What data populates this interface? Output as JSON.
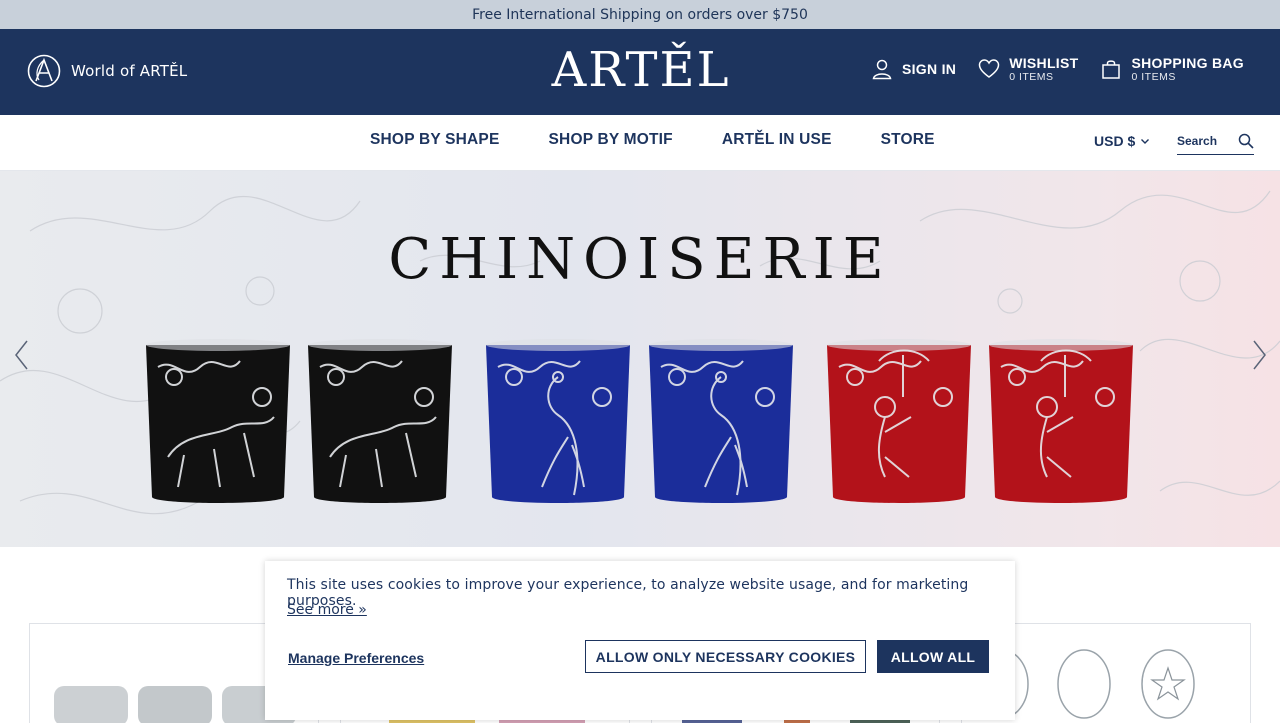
{
  "promo": {
    "text": "Free International Shipping on orders over $750"
  },
  "header": {
    "world_label": "World of ARTĚL",
    "brand": "ARTĚL",
    "sign_in": "SIGN IN",
    "wishlist": {
      "label": "WISHLIST",
      "count": "0 ITEMS"
    },
    "bag": {
      "label": "SHOPPING BAG",
      "count": "0 ITEMS"
    }
  },
  "nav": {
    "items": [
      {
        "label": "SHOP BY SHAPE"
      },
      {
        "label": "SHOP BY MOTIF"
      },
      {
        "label": "ARTĚL IN USE"
      },
      {
        "label": "STORE"
      }
    ],
    "currency": "USD $",
    "search_placeholder": "Search"
  },
  "hero": {
    "title": "CHINOISERIE",
    "glasses": [
      {
        "motif": "leopard",
        "color": "#111111"
      },
      {
        "motif": "leopard",
        "color": "#111111"
      },
      {
        "motif": "peacock",
        "color": "#1b2d9a"
      },
      {
        "motif": "peacock",
        "color": "#1b2d9a"
      },
      {
        "motif": "monkey",
        "color": "#b3121a"
      },
      {
        "motif": "monkey",
        "color": "#b3121a"
      }
    ]
  },
  "cookie": {
    "message": "This site uses cookies to improve your experience, to analyze website usage, and for marketing purposes.",
    "see_more": "See more »",
    "manage": "Manage Preferences",
    "necessary": "ALLOW ONLY NECESSARY COOKIES",
    "allow_all": "ALLOW ALL"
  },
  "colors": {
    "navy": "#1d345e",
    "promo_bg": "#c8d0da"
  }
}
